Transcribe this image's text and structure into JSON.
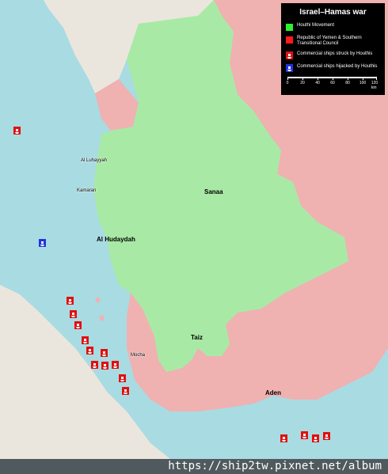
{
  "legend": {
    "title": "Israel–Hamas war",
    "items": [
      {
        "label": "Houthi Movement",
        "color": "#2ef02e",
        "kind": "swatch"
      },
      {
        "label": "Republic of Yemen & Southern Transitional Council",
        "color": "#ff1a1a",
        "kind": "swatch"
      },
      {
        "label": "Commercial ships struck by Houthis",
        "color": "#e01010",
        "kind": "ship"
      },
      {
        "label": "Commercial ships hijacked by Houthis",
        "color": "#2233dd",
        "kind": "ship"
      }
    ],
    "scale": {
      "ticks": [
        "0",
        "20",
        "40",
        "60",
        "80",
        "100",
        "120 km"
      ]
    }
  },
  "places": {
    "al_luhayyah": "Al Luhayyah",
    "kamaran": "Kamaran",
    "al_hudaydah": "Al Hudaydah",
    "sanaa": "Sanaa",
    "taiz": "Taiz",
    "mocha": "Mocha",
    "aden": "Aden"
  },
  "colors": {
    "sea": "#a9dbe3",
    "houthi": "#a8eaa5",
    "government": "#f0b1b1",
    "land_outside": "#ece7e0"
  },
  "watermark": "https://ship2tw.pixnet.net/album"
}
